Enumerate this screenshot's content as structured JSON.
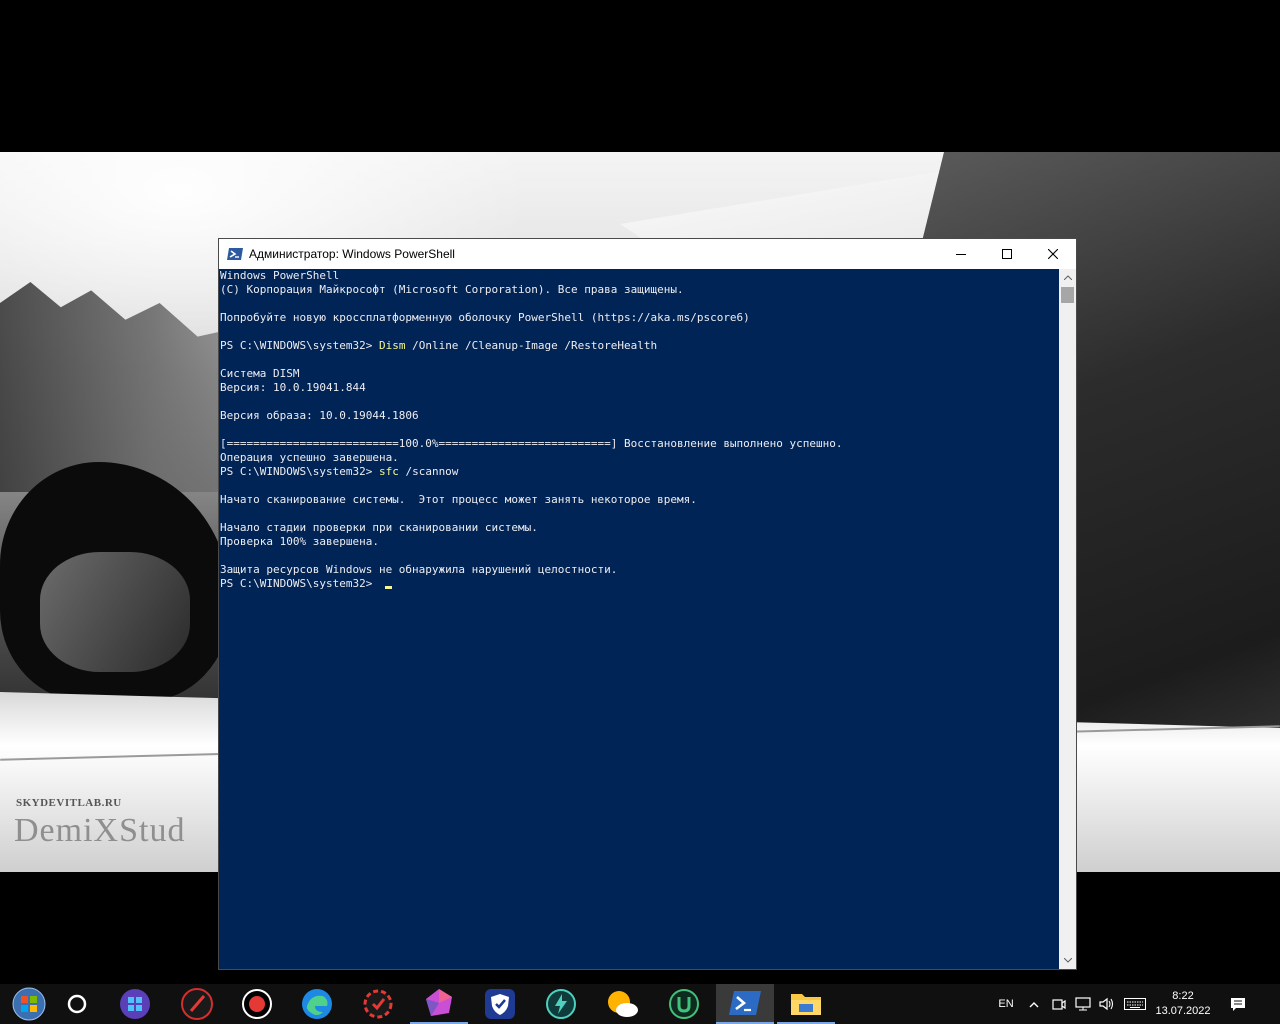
{
  "window": {
    "title": "Администратор: Windows PowerShell",
    "controls": {
      "minimize": "—",
      "maximize": "☐",
      "close": "✕"
    }
  },
  "console": {
    "lines": [
      {
        "text": "Windows PowerShell"
      },
      {
        "text": "(C) Корпорация Майкрософт (Microsoft Corporation). Все права защищены."
      },
      {
        "text": ""
      },
      {
        "text": "Попробуйте новую кроссплатформенную оболочку PowerShell (https://aka.ms/pscore6)"
      },
      {
        "text": ""
      },
      {
        "prompt": "PS C:\\WINDOWS\\system32> ",
        "cmd": "Dism",
        "args": " /Online /Cleanup-Image /RestoreHealth"
      },
      {
        "text": ""
      },
      {
        "text": "Cистема DISM"
      },
      {
        "text": "Версия: 10.0.19041.844"
      },
      {
        "text": ""
      },
      {
        "text": "Версия образа: 10.0.19044.1806"
      },
      {
        "text": ""
      },
      {
        "text": "[==========================100.0%==========================] Восстановление выполнено успешно."
      },
      {
        "text": "Операция успешно завершена."
      },
      {
        "prompt": "PS C:\\WINDOWS\\system32> ",
        "cmd": "sfc",
        "args": " /scannow"
      },
      {
        "text": ""
      },
      {
        "text": "Начато сканирование системы.  Этот процесс может занять некоторое время."
      },
      {
        "text": ""
      },
      {
        "text": "Начало стадии проверки при сканировании системы."
      },
      {
        "text": "Проверка 100% завершена."
      },
      {
        "text": ""
      },
      {
        "text": "Защита ресурсов Windows не обнаружила нарушений целостности."
      },
      {
        "prompt": "PS C:\\WINDOWS\\system32> ",
        "cmd": "",
        "args": "",
        "cursor": true
      }
    ]
  },
  "wallpaper": {
    "watermark": "DemiXStud",
    "watermark_small": "SKYDEVITLAB.RU"
  },
  "taskbar": {
    "items": [
      {
        "name": "start-button",
        "icon": "windows-orb-icon"
      },
      {
        "name": "cortana-button",
        "icon": "circle-icon"
      },
      {
        "name": "taskbar-app-1",
        "icon": "store-hex-icon"
      },
      {
        "name": "taskbar-app-2",
        "icon": "brush-icon"
      },
      {
        "name": "taskbar-app-3",
        "icon": "record-icon"
      },
      {
        "name": "taskbar-app-edge",
        "icon": "edge-icon"
      },
      {
        "name": "taskbar-app-5",
        "icon": "gear-red-icon"
      },
      {
        "name": "taskbar-app-6",
        "icon": "gem-icon",
        "state": "running"
      },
      {
        "name": "taskbar-app-7",
        "icon": "shield-icon"
      },
      {
        "name": "taskbar-app-8",
        "icon": "bolt-circle-icon"
      },
      {
        "name": "taskbar-app-weather",
        "icon": "weather-icon"
      },
      {
        "name": "taskbar-app-10",
        "icon": "u-circle-icon"
      },
      {
        "name": "taskbar-app-powershell",
        "icon": "powershell-icon",
        "state": "active"
      },
      {
        "name": "taskbar-app-explorer",
        "icon": "folder-icon",
        "state": "running"
      }
    ],
    "tray": {
      "language": "EN",
      "time": "8:22",
      "date": "13.07.2022"
    }
  },
  "colors": {
    "console_bg": "#012456",
    "console_text": "#eeedf0",
    "command": "#f7f791",
    "taskbar_bg": "#101010",
    "accent": "#7aa7e6"
  }
}
